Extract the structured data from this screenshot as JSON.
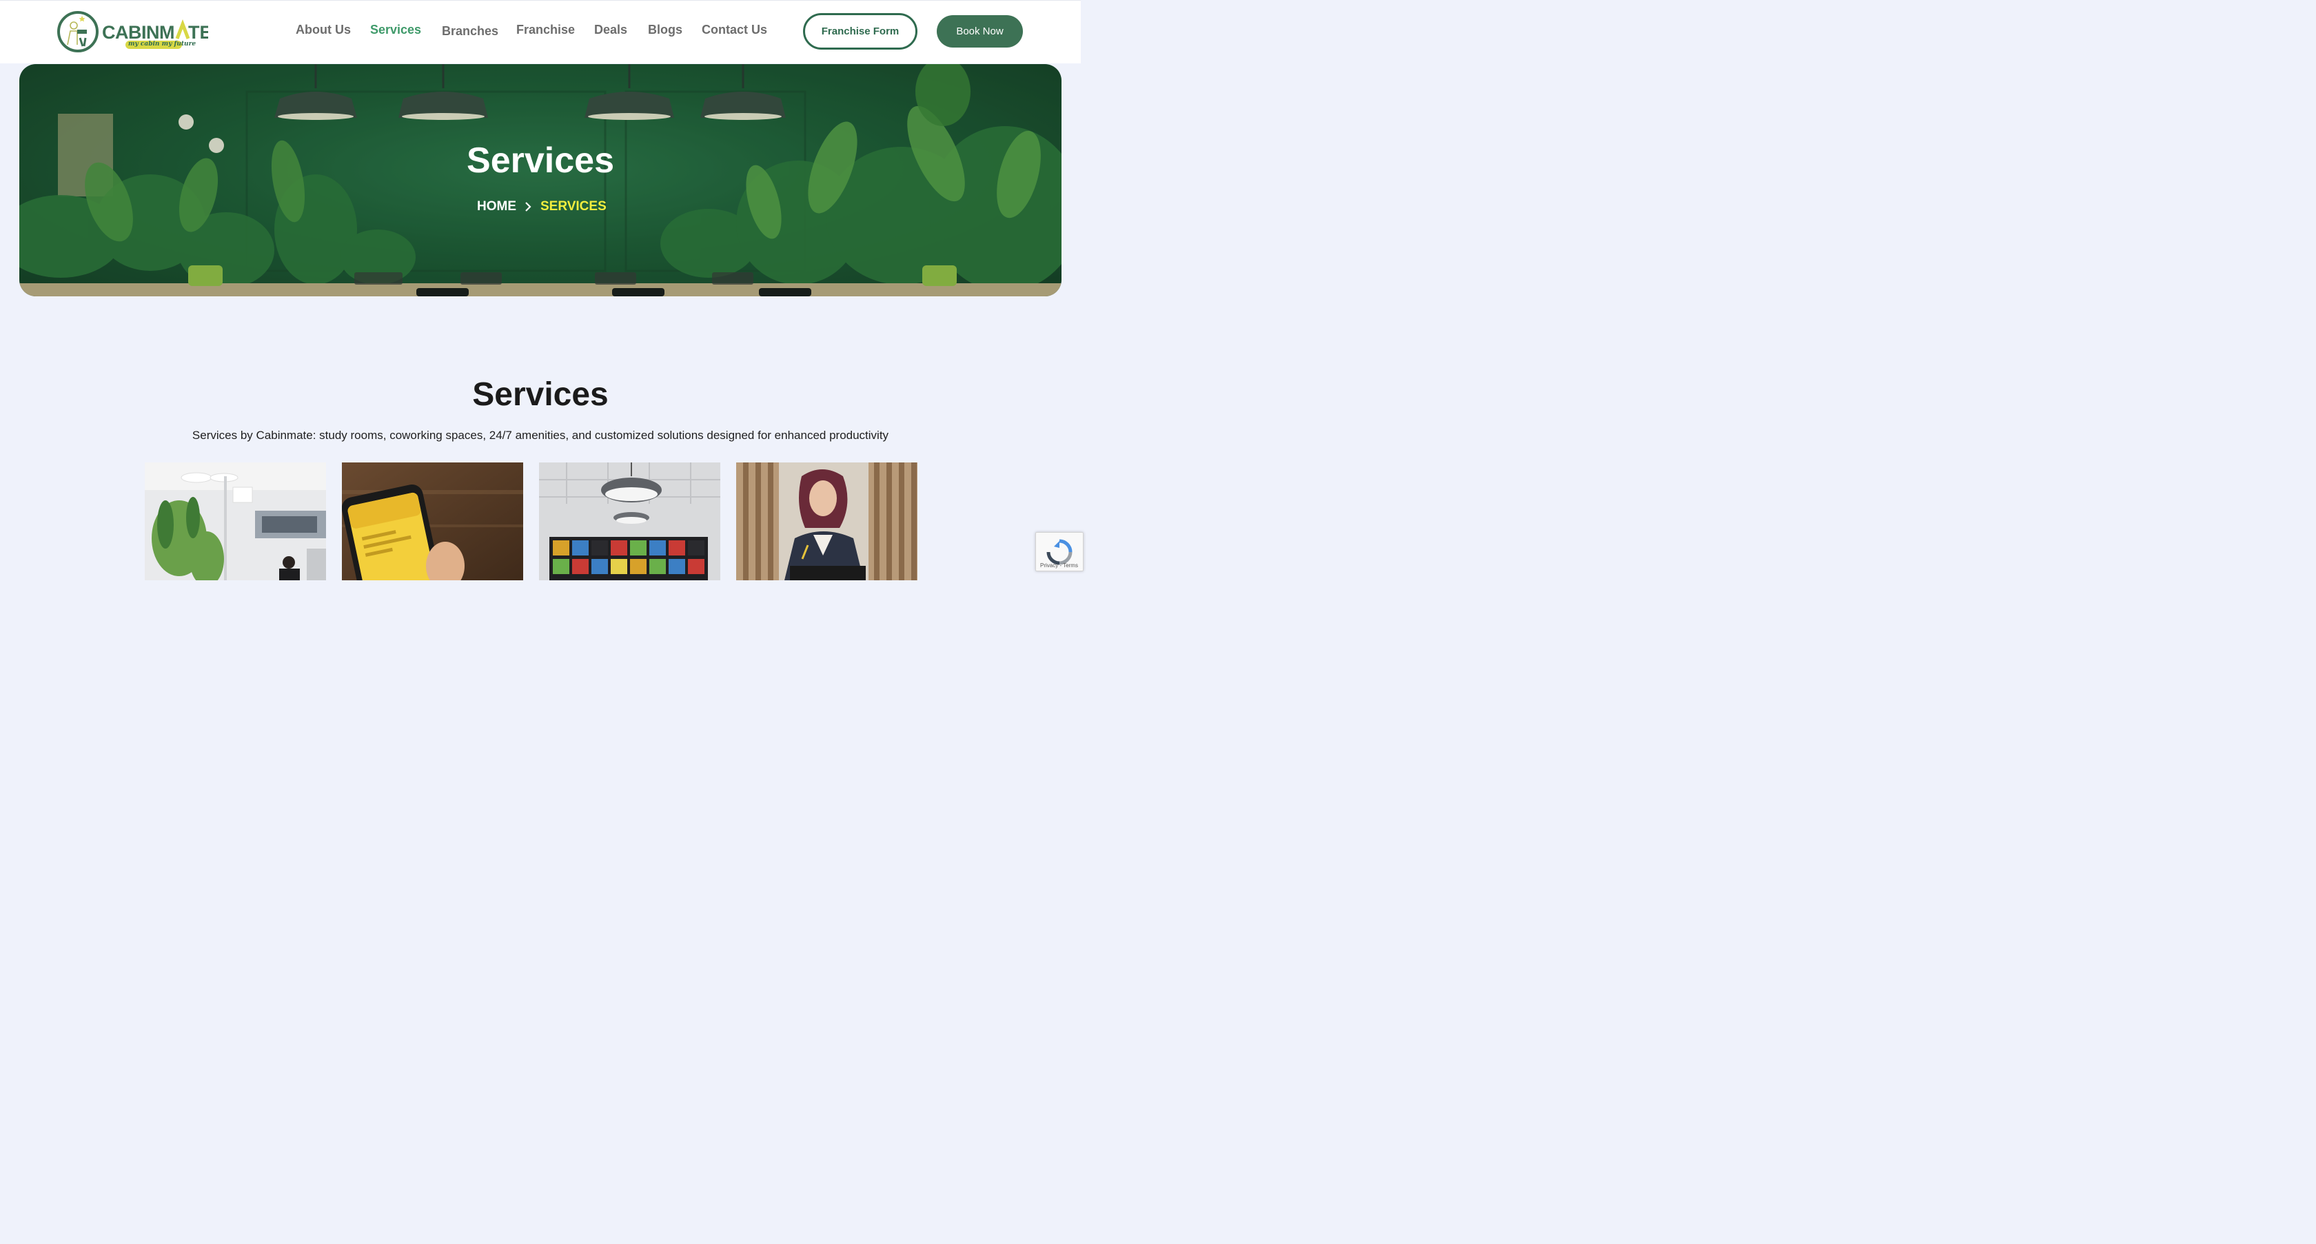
{
  "brand": {
    "name": "CABINMATE",
    "tagline": "my cabin my future"
  },
  "nav": {
    "items": [
      {
        "label": "About Us",
        "active": false
      },
      {
        "label": "Services",
        "active": true
      },
      {
        "label": "Branches",
        "active": false
      },
      {
        "label": "Franchise",
        "active": false
      },
      {
        "label": "Deals",
        "active": false
      },
      {
        "label": "Blogs",
        "active": false
      },
      {
        "label": "Contact Us",
        "active": false
      }
    ],
    "franchise_button": "Franchise Form",
    "book_button": "Book Now"
  },
  "hero": {
    "title": "Services",
    "breadcrumb_home": "HOME",
    "breadcrumb_current": "SERVICES"
  },
  "section": {
    "title": "Services",
    "subtitle": "Services by Cabinmate: study rooms, coworking spaces, 24/7 amenities, and customized solutions designed for enhanced productivity"
  },
  "cards": [
    {
      "image": "office-workspace-photo"
    },
    {
      "image": "phone-app-photo"
    },
    {
      "image": "lockers-room-photo"
    },
    {
      "image": "woman-studying-photo"
    }
  ],
  "recaptcha": {
    "links": "Privacy - Terms"
  },
  "colors": {
    "brand_green": "#3d7255",
    "active_nav": "#3f9a6a",
    "breadcrumb_current": "#f2ee3e",
    "page_bg": "#eff2fb"
  }
}
